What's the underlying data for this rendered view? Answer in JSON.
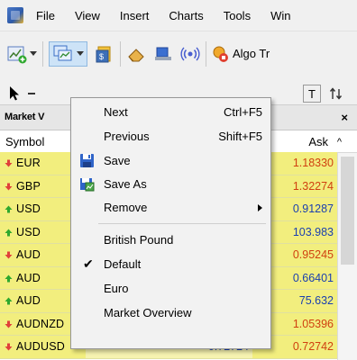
{
  "menubar": {
    "items": [
      "File",
      "View",
      "Insert",
      "Charts",
      "Tools",
      "Win"
    ]
  },
  "toolbar": {
    "algo_trading_label": "Algo Tr"
  },
  "toolbar2": {
    "text_tool": "T"
  },
  "panel": {
    "title": "Market V",
    "close": "×"
  },
  "columns": {
    "symbol": "Symbol",
    "ask": "Ask",
    "sort_arrow": "^"
  },
  "rows": [
    {
      "symbol": "EUR",
      "bid": "",
      "ask": "1.18330",
      "dir": "down",
      "ask_color": "#d04010"
    },
    {
      "symbol": "GBP",
      "bid": "",
      "ask": "1.32274",
      "dir": "down",
      "ask_color": "#d04010"
    },
    {
      "symbol": "USD",
      "bid": "",
      "ask": "0.91287",
      "dir": "up",
      "ask_color": "#1a3fb0"
    },
    {
      "symbol": "USD",
      "bid": "",
      "ask": "103.983",
      "dir": "up",
      "ask_color": "#1a3fb0"
    },
    {
      "symbol": "AUD",
      "bid": "",
      "ask": "0.95245",
      "dir": "down",
      "ask_color": "#d04010"
    },
    {
      "symbol": "AUD",
      "bid": "",
      "ask": "0.66401",
      "dir": "up",
      "ask_color": "#1a3fb0"
    },
    {
      "symbol": "AUD",
      "bid": "",
      "ask": "75.632",
      "dir": "up",
      "ask_color": "#1a3fb0"
    },
    {
      "symbol": "AUDNZD",
      "bid": "1.05374",
      "ask": "1.05396",
      "dir": "down",
      "ask_color": "#d04010"
    },
    {
      "symbol": "AUDUSD",
      "bid": "0.72724",
      "ask": "0.72742",
      "dir": "down",
      "ask_color": "#d04010"
    }
  ],
  "context_menu": {
    "next": {
      "label": "Next",
      "shortcut": "Ctrl+F5"
    },
    "previous": {
      "label": "Previous",
      "shortcut": "Shift+F5"
    },
    "save": {
      "label": "Save"
    },
    "save_as": {
      "label": "Save As"
    },
    "remove": {
      "label": "Remove"
    },
    "british_pound": {
      "label": "British Pound"
    },
    "default": {
      "label": "Default",
      "checked": true
    },
    "euro": {
      "label": "Euro"
    },
    "market_overview": {
      "label": "Market Overview"
    }
  },
  "colors": {
    "up_arrow": "#2ea82e",
    "down_arrow": "#e0403a",
    "row_bg": "#f2ee7e",
    "row_bg_light": "#f6f3b0"
  }
}
